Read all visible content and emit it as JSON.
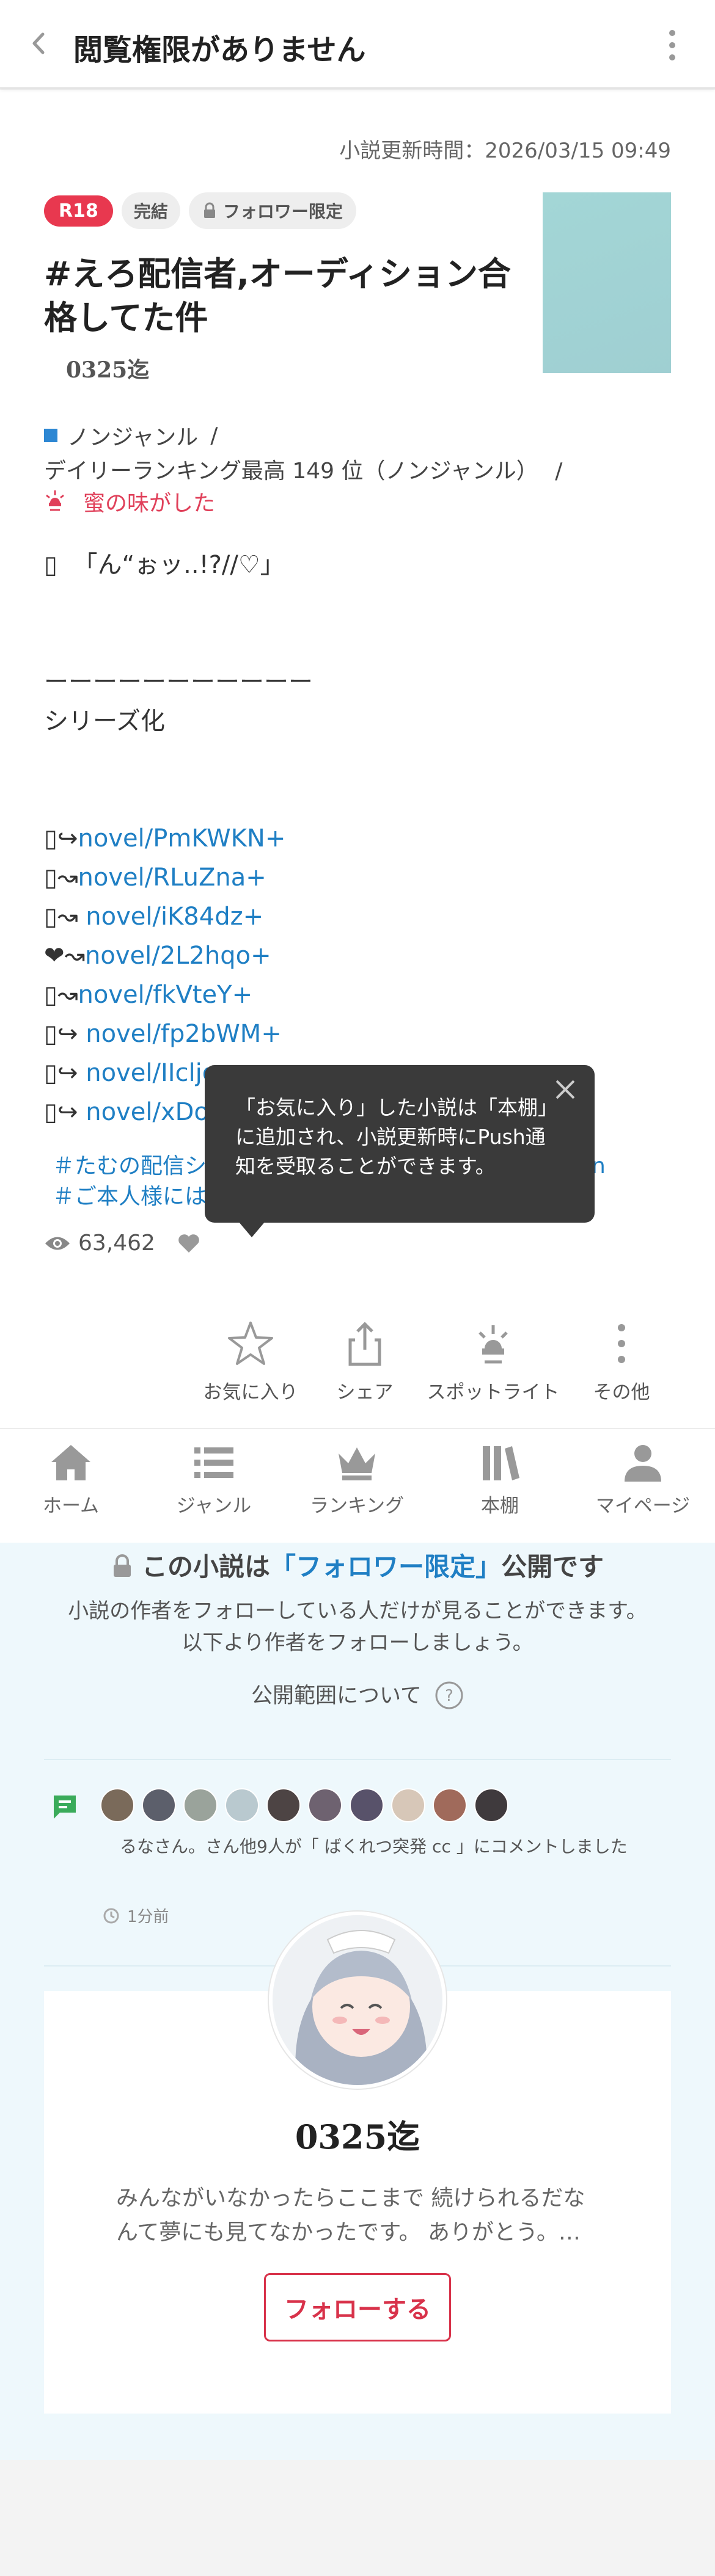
{
  "header": {
    "title": "閲覧権限がありません"
  },
  "novel": {
    "update_time": "小説更新時間：2026/03/15 09:49",
    "badges": {
      "r18": "R18",
      "complete": "完結",
      "follower": "フォロワー限定"
    },
    "title_line1": "#えろ配信者,オーディション合",
    "title_line2": "格してた件",
    "author": "0325迄",
    "genre": "ノンジャンル",
    "genre_sep": "/",
    "ranking": "デイリーランキング最高 149 位（ノンジャンル）",
    "ranking_sep": "/",
    "spotlight": "蜜の味がした",
    "description_lines": [
      "  「ん“ぉッ..!?//♡」",
      "",
      "",
      "ーーーーーーーーーーー",
      "シリーズ化",
      "",
      ""
    ],
    "series_links": [
      {
        "prefix": "↪",
        "text": "novel/PmKWKN+"
      },
      {
        "prefix": "↝",
        "text": "novel/RLuZna+"
      },
      {
        "prefix": "↝ ",
        "text": "novel/iK84dz+"
      },
      {
        "prefix": "❤↝",
        "text": "novel/2L2hqo+"
      },
      {
        "prefix": "↝",
        "text": "novel/fkVteY+"
      },
      {
        "prefix": "↪ ",
        "text": "novel/fp2bWM+"
      },
      {
        "prefix": "↪ ",
        "text": "novel/IIcljg+"
      },
      {
        "prefix": "↪ ",
        "text": "novel/xDot6e+"
      }
    ],
    "tags": [
      "＃たむの配信シ",
      "＃ご本人様には"
    ],
    "tag_tail": "n",
    "views": "63,462"
  },
  "tooltip": {
    "line1": "「お気に入り」した小説は「本棚」",
    "line2": "に追加され、小説更新時にPush通",
    "line3": "知を受取ることができます。"
  },
  "actions": {
    "favorite": "お気に入り",
    "share": "シェア",
    "spotlight": "スポットライト",
    "more": "その他"
  },
  "tabs": {
    "home": "ホーム",
    "genre": "ジャンル",
    "ranking": "ランキング",
    "bookshelf": "本棚",
    "mypage": "マイページ"
  },
  "restricted": {
    "title_pre": "この小説は",
    "title_hl": "「フォロワー限定」",
    "title_post": "公開です",
    "desc_line1": "小説の作者をフォローしている人だけが見ることができます。",
    "desc_line2": "以下より作者をフォローしましょう。",
    "scope_link": "公開範囲について"
  },
  "activity": {
    "text": "るなさん。さん他9人が「 ばくれつ突発 cc 」にコメントしました",
    "time": "1分前",
    "avatar_colors": [
      "#7a6a5a",
      "#5c5f6b",
      "#9aa39b",
      "#b9c9cf",
      "#4d4444",
      "#6e6270",
      "#58526a",
      "#d7c7b8",
      "#a06a5b",
      "#3f3a3d"
    ]
  },
  "author_card": {
    "name": "0325迄",
    "bio_line1": "みんながいなかったらここまで 続けられるだな",
    "bio_line2": "んて夢にも見てなかったです。 ありがとう。…",
    "follow_label": "フォローする"
  }
}
